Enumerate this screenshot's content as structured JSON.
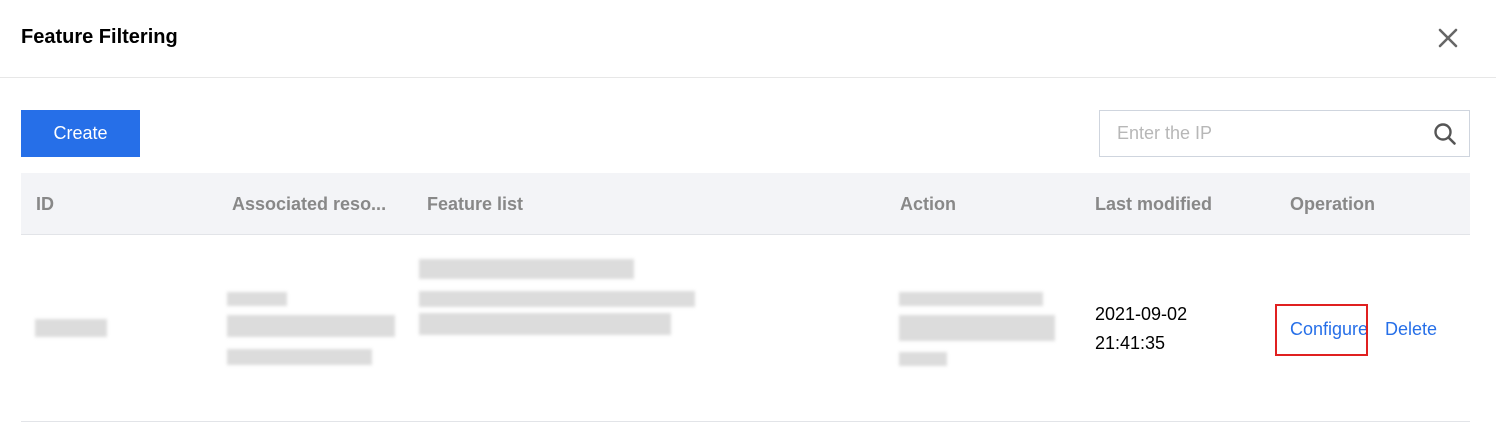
{
  "dialog": {
    "title": "Feature Filtering",
    "close_icon": "close-icon"
  },
  "toolbar": {
    "create_label": "Create",
    "search_placeholder": "Enter the IP",
    "search_value": "",
    "search_icon": "search-icon"
  },
  "table": {
    "columns": [
      {
        "label": "ID"
      },
      {
        "label": "Associated reso..."
      },
      {
        "label": "Feature list"
      },
      {
        "label": "Action"
      },
      {
        "label": "Last modified"
      },
      {
        "label": "Operation"
      }
    ],
    "rows": [
      {
        "id": "",
        "associated_resources": "",
        "feature_list": "",
        "action": "",
        "last_modified_date": "2021-09-02",
        "last_modified_time": "21:41:35",
        "operations": [
          {
            "label": "Configure"
          },
          {
            "label": "Delete"
          }
        ]
      }
    ]
  },
  "colors": {
    "primary": "#266fe8",
    "highlight_box": "#e02020",
    "header_bg": "#f3f4f7"
  }
}
